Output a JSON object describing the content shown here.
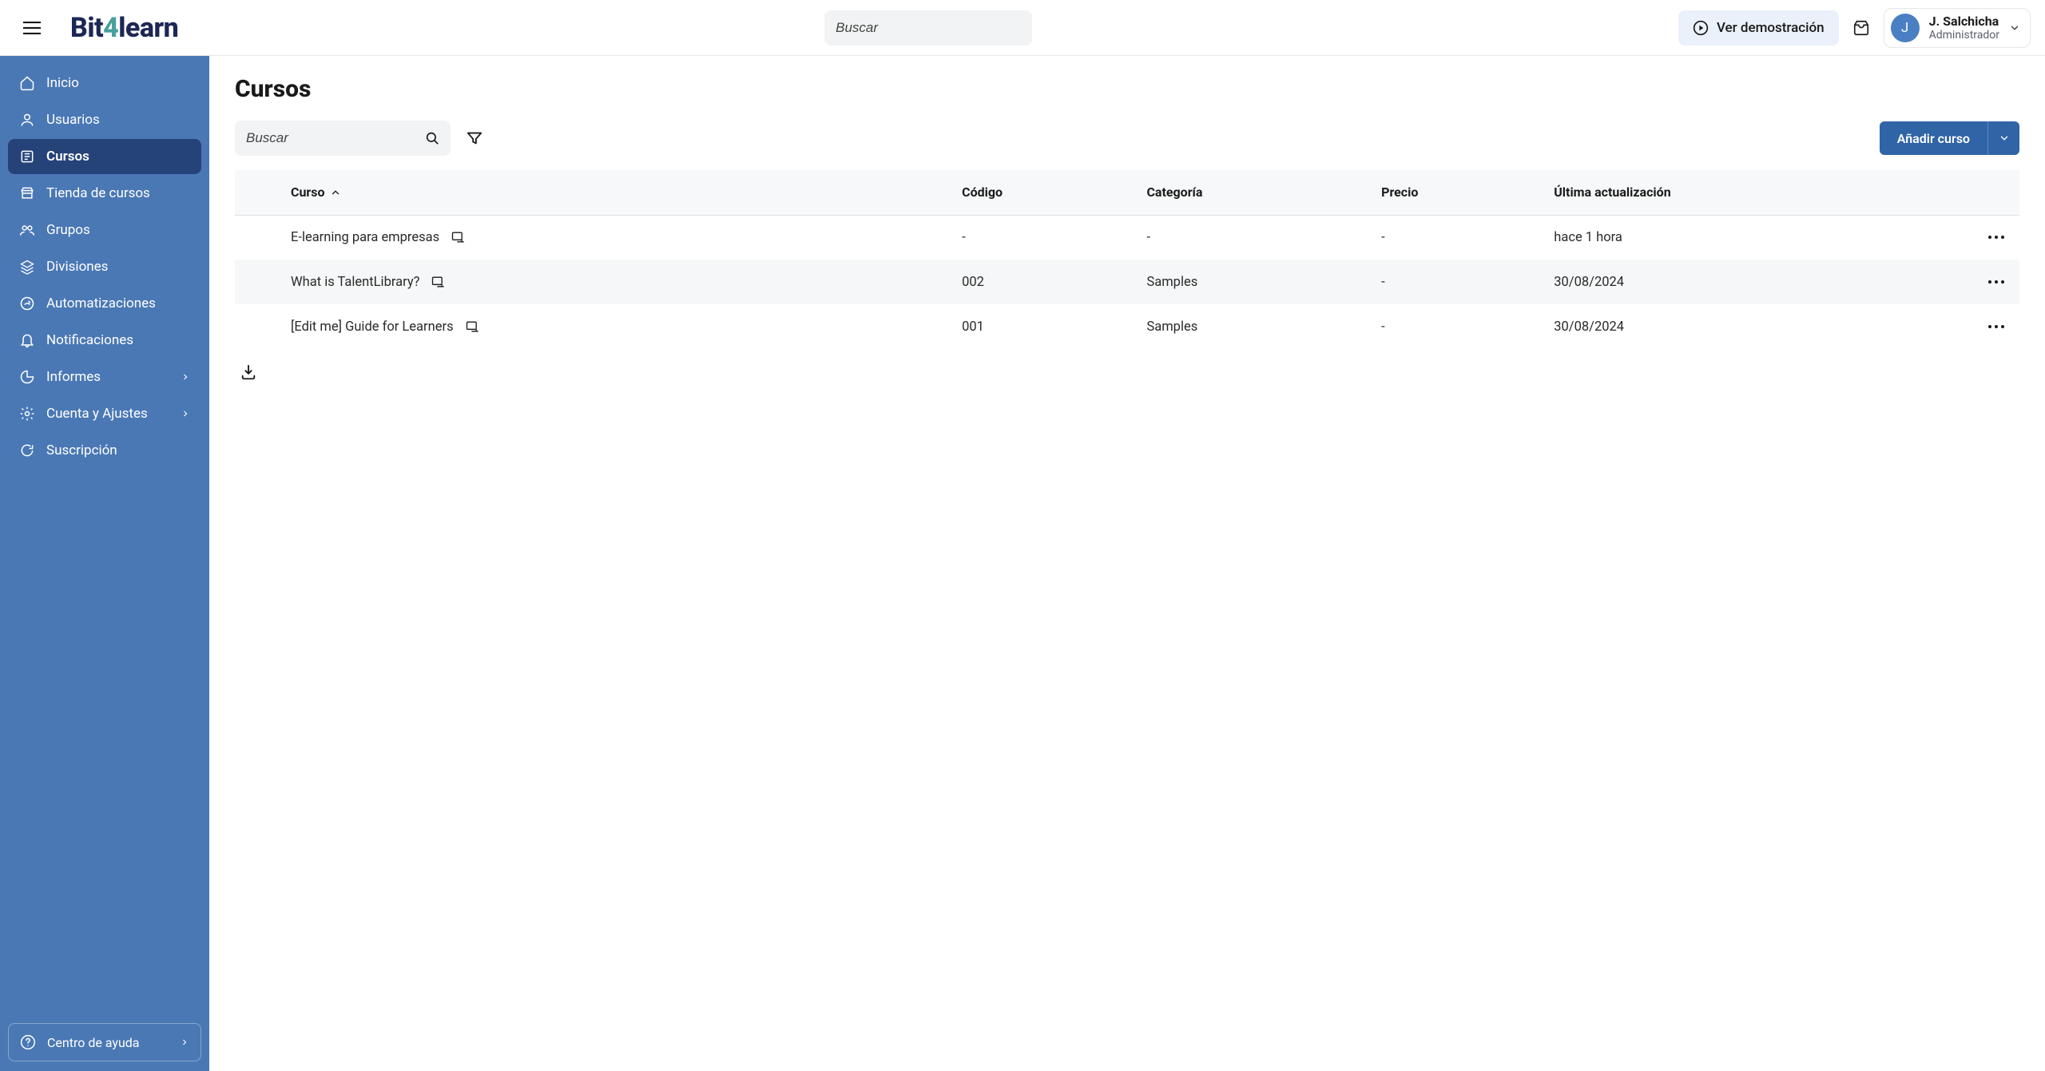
{
  "brand": {
    "prefix": "Bit",
    "mid": "4",
    "suffix": "learn"
  },
  "header": {
    "search_placeholder": "Buscar",
    "demo_label": "Ver demostración"
  },
  "user": {
    "initial": "J",
    "name": "J. Salchicha",
    "role": "Administrador"
  },
  "sidebar": {
    "items": [
      {
        "label": "Inicio"
      },
      {
        "label": "Usuarios"
      },
      {
        "label": "Cursos"
      },
      {
        "label": "Tienda de cursos"
      },
      {
        "label": "Grupos"
      },
      {
        "label": "Divisiones"
      },
      {
        "label": "Automatizaciones"
      },
      {
        "label": "Notificaciones"
      },
      {
        "label": "Informes"
      },
      {
        "label": "Cuenta y Ajustes"
      },
      {
        "label": "Suscripción"
      }
    ],
    "help_label": "Centro de ayuda"
  },
  "page": {
    "title": "Cursos",
    "search_placeholder": "Buscar",
    "add_button": "Añadir curso",
    "columns": {
      "course": "Curso",
      "code": "Código",
      "category": "Categoría",
      "price": "Precio",
      "updated": "Última actualización"
    },
    "rows": [
      {
        "course": "E-learning para empresas",
        "code": "-",
        "category": "-",
        "price": "-",
        "updated": "hace 1 hora"
      },
      {
        "course": "What is TalentLibrary?",
        "code": "002",
        "category": "Samples",
        "price": "-",
        "updated": "30/08/2024"
      },
      {
        "course": "[Edit me] Guide for Learners",
        "code": "001",
        "category": "Samples",
        "price": "-",
        "updated": "30/08/2024"
      }
    ]
  }
}
